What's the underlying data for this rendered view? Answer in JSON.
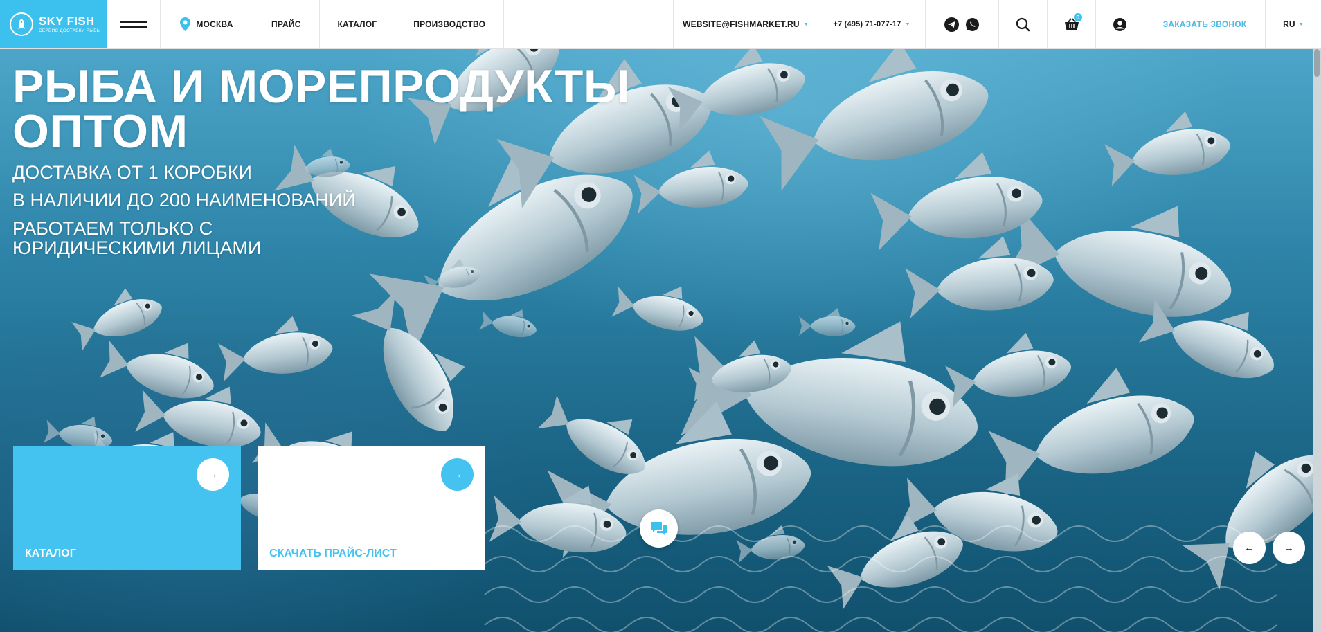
{
  "header": {
    "logo": {
      "name": "SKY FISH",
      "tagline": "СЕРВИС ДОСТАВКИ РЫБЫ"
    },
    "city": "МОСКВА",
    "nav": [
      "ПРАЙС",
      "КАТАЛОГ",
      "ПРОИЗВОДСТВО"
    ],
    "email": "WEBSITE@FISHMARKET.RU",
    "phone": "+7 (495) 71-077-17",
    "cart_count": "0",
    "callback_label": "ЗАКАЗАТЬ ЗВОНОК",
    "language": "RU",
    "icons": [
      "menu-icon",
      "location-pin-icon",
      "telegram-icon",
      "whatsapp-icon",
      "search-icon",
      "cart-icon",
      "user-icon"
    ]
  },
  "hero": {
    "title_line1": "РЫБА И МОРЕПРОДУКТЫ",
    "title_line2": "ОПТОМ",
    "features": [
      "ДОСТАВКА ОТ 1 КОРОБКИ",
      "В НАЛИЧИИ ДО 200 НАИМЕНОВАНИЙ",
      "РАБОТАЕМ ТОЛЬКО С",
      "ЮРИДИЧЕСКИМИ ЛИЦАМИ"
    ],
    "cards": [
      {
        "label": "КАТАЛОГ"
      },
      {
        "label": "СКАЧАТЬ ПРАЙС-ЛИСТ"
      }
    ],
    "arrow_glyph": "→",
    "prev_glyph": "←",
    "next_glyph": "→"
  },
  "colors": {
    "accent": "#3cc1ee",
    "header_bg": "#ffffff",
    "text_dark": "#1b1b1b",
    "water_dark": "#10506d",
    "water_light": "#4da6c9"
  }
}
